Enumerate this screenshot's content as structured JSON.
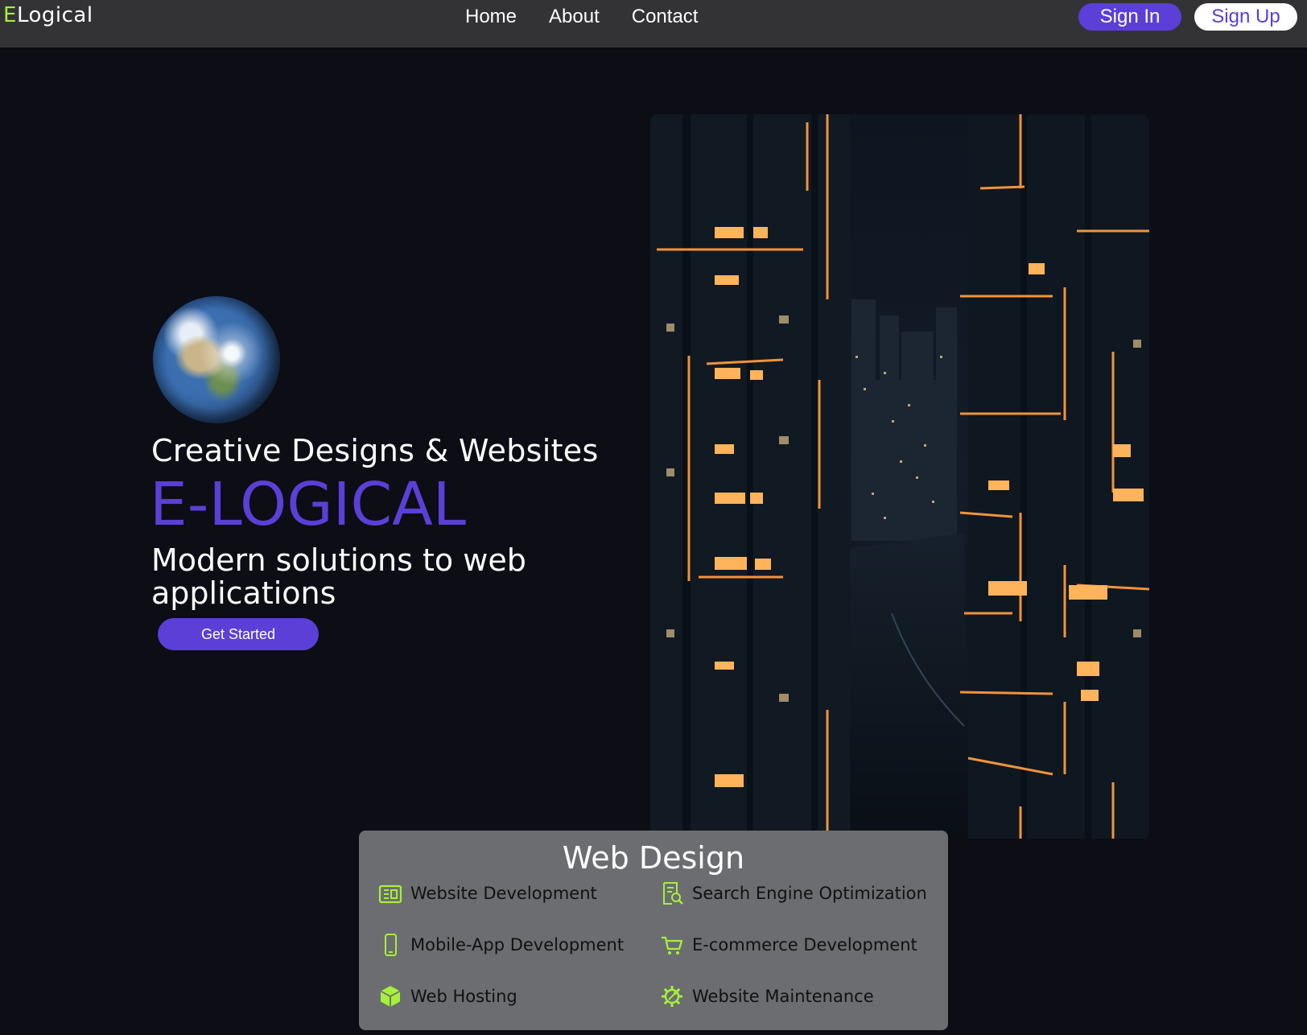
{
  "nav": {
    "logo_accent": "E",
    "logo_rest": "Logical",
    "links": [
      "Home",
      "About",
      "Contact"
    ],
    "sign_in": "Sign In",
    "sign_up": "Sign Up"
  },
  "hero": {
    "tagline": "Creative Designs & Websites",
    "brand": "E-LOGICAL",
    "subtitle": "Modern solutions to web applications",
    "cta": "Get Started"
  },
  "services": {
    "title": "Web Design",
    "items": [
      {
        "label": "Website Development",
        "icon": "website-icon"
      },
      {
        "label": "Search Engine Optimization",
        "icon": "seo-icon"
      },
      {
        "label": "Mobile-App Development",
        "icon": "mobile-icon"
      },
      {
        "label": "E-commerce Development",
        "icon": "cart-icon"
      },
      {
        "label": "Web Hosting",
        "icon": "hosting-cube-icon"
      },
      {
        "label": "Website Maintenance",
        "icon": "maintenance-gear-icon"
      }
    ]
  },
  "colors": {
    "accent_purple": "#5b3fd6",
    "accent_green": "#a6f03a",
    "navbar": "#333336",
    "background": "#0c0d15",
    "card": "#6b6d70"
  }
}
